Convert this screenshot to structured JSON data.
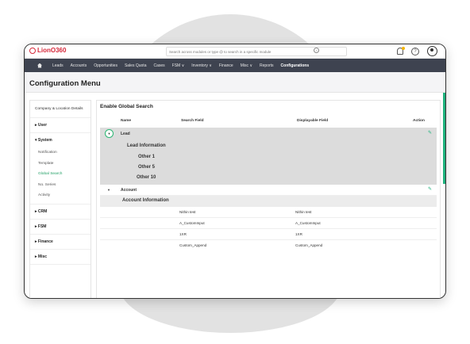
{
  "app": {
    "logo": "LionO360",
    "search_placeholder": "Search across modules or type @ to search in a specific module"
  },
  "nav": {
    "items": [
      "Leads",
      "Accounts",
      "Opportunities",
      "Sales Quota",
      "Cases",
      "FSM ∨",
      "Inventory ∨",
      "Finance",
      "Misc ∨",
      "Reports",
      "Configurations"
    ],
    "active": "Configurations"
  },
  "page_title": "Configuration Menu",
  "sidebar": {
    "header": "Company & Location Details",
    "user": "User",
    "system": "System",
    "system_items": [
      "Notification",
      "Template",
      "Global Search",
      "No. Series",
      "Activity"
    ],
    "crm": "CRM",
    "fsm": "FSM",
    "finance": "Finance",
    "misc": "Misc"
  },
  "content": {
    "title": "Enable Global Search",
    "columns": {
      "name": "Name",
      "search": "Search Field",
      "display": "Displayable Field",
      "action": "Action"
    },
    "lead": {
      "name": "Lead",
      "group": "Lead Information",
      "subs": [
        "Other 1",
        "Other 5",
        "Other 10"
      ]
    },
    "account": {
      "name": "Account",
      "group": "Account Information",
      "fields": [
        {
          "search": "Nithin test",
          "display": "Nithin test"
        },
        {
          "search": "A_CustomInput",
          "display": "A_CustomInput"
        },
        {
          "search": "1XR",
          "display": "1XR"
        },
        {
          "search": "Custom_Append",
          "display": "Custom_Append"
        }
      ]
    }
  }
}
